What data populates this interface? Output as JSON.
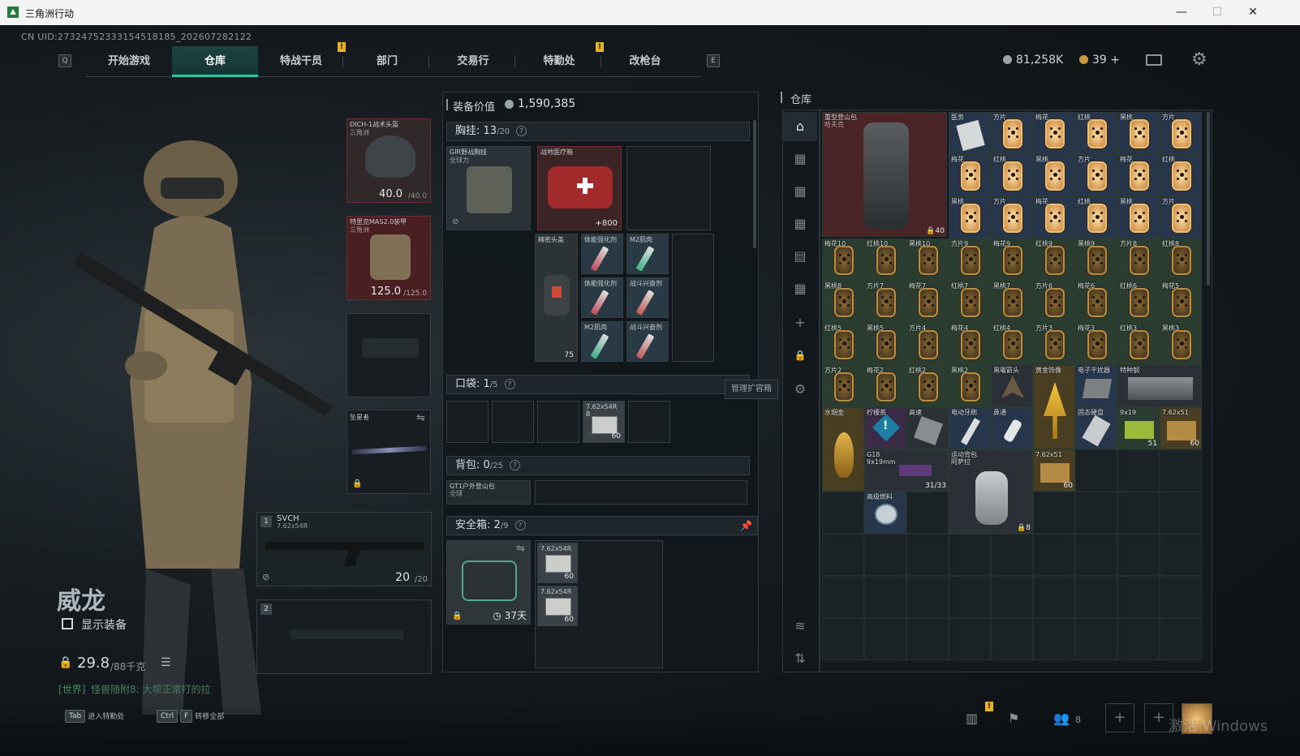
{
  "window": {
    "title": "三角洲行动",
    "minimize": "—",
    "maximize": "☐",
    "close": "✕"
  },
  "uid": "CN UID:2732475233315451818​5_202607282122",
  "nav": {
    "key_left": "Q",
    "key_right": "E",
    "tabs": [
      "开始游戏",
      "仓库",
      "特战干员",
      "部门",
      "交易行",
      "特勤处",
      "改枪台"
    ],
    "active_tab": "仓库",
    "notif_marker": "!"
  },
  "currency": {
    "silver": "81,258K",
    "gold": "39",
    "plus": "+"
  },
  "operator": {
    "name": "威龙",
    "show_gear_label": "显示装备",
    "weight_value": "29.8",
    "weight_max": "/88千克",
    "chat_channel": "[世界]",
    "chat_text": "怪兽随附8: 大坝正常打的拉"
  },
  "gear": {
    "helmet": {
      "name": "DICH-1战术头盔",
      "sub": "三角洲",
      "durability": "40.0",
      "max": "/40.0"
    },
    "armor": {
      "name": "特里克MAS2.0装甲",
      "sub": "三角洲",
      "durability": "125.0",
      "max": "/125.0"
    },
    "melee": {
      "name": "坠星者"
    },
    "primary": {
      "index": "1",
      "name": "SVCH",
      "caliber": "7.62x54R",
      "ammo": "20",
      "ammo_max": "/20"
    },
    "secondary": {
      "index": "2"
    }
  },
  "equipment": {
    "value_label": "装备价值",
    "value": "1,590,385",
    "chest": {
      "label": "胸挂:",
      "count": "13",
      "max": "/20"
    },
    "chest_rig": {
      "name": "GIR野战胸挂",
      "sub": "全球力"
    },
    "medkit": {
      "name": "战地医疗箱",
      "value": "800"
    },
    "headband": {
      "name": "精密头盖",
      "value": "75"
    },
    "consumables": [
      "体能强化剂",
      "M2肌肉",
      "体能强化剂",
      "战斗兴奋剂",
      "M2肌肉",
      "战斗兴奋剂"
    ],
    "pocket": {
      "label": "口袋:",
      "count": "1",
      "max": "/5",
      "item": "7.62x54R",
      "item_sub": "B",
      "item_count": "60"
    },
    "manage_label": "管理扩容箱",
    "backpack": {
      "label": "背包:",
      "count": "0",
      "max": "/25",
      "item": "GT1户外登山包",
      "item_sub": "全球"
    },
    "safe": {
      "label": "安全箱:",
      "count": "2",
      "max": "/9",
      "days": "37天",
      "ammo": [
        "7.62x54R",
        "7.62x54R"
      ],
      "ammo_count": [
        "60",
        "60"
      ]
    }
  },
  "warehouse": {
    "title": "仓库",
    "big_backpack": {
      "name": "重型登山包",
      "sub": "哈夫克",
      "count": "40"
    },
    "top_cells": [
      "医务",
      "方片",
      "梅花",
      "红桃",
      "黑桃",
      "方片",
      "梅花",
      "红桃",
      "黑桃",
      "方片",
      "梅花",
      "红桃",
      "黑桃",
      "方片",
      "梅花",
      "红桃",
      "黑桃",
      "方片"
    ],
    "grid_cells": [
      "梅花10",
      "红桃10",
      "黑桃10",
      "方片9",
      "梅花9",
      "红桃9",
      "黑桃9",
      "方片8",
      "红桃8",
      "黑桃8",
      "方片7",
      "梅花7",
      "红桃7",
      "黑桃7",
      "方片6",
      "梅花6",
      "红桃6",
      "梅花5",
      "红桃5",
      "黑桃5",
      "方片4",
      "梅花4",
      "红桃4",
      "方片3",
      "梅花3",
      "红桃3",
      "黑桃3",
      "方片2",
      "梅花2",
      "红桃2",
      "黑桃2"
    ],
    "misc": {
      "arrowhead": "黑曜箭头",
      "idol": "黄金饰像",
      "laptop": "电子干扰器",
      "plate": "特种钢",
      "hookah": "水烟壶",
      "alert": "柠檬茶",
      "chip": "高速",
      "toothbrush": "电动牙刷",
      "inhaler": "鼻通",
      "knife_case": "固态硬盘",
      "ammo919": "9x19",
      "ammo919_count": "51",
      "ammo762": "7.62x51",
      "ammo762_count": "60",
      "pistol": "G18",
      "pistol_cal": "9x19mm",
      "pistol_ammo": "31/33",
      "sport_bag": "运动背包",
      "sport_bag_sub": "阿萨拉",
      "sport_bag_count": "8",
      "ammo_box2": "7.62x51",
      "ammo_box2_count": "60",
      "canned": "高级燃料"
    }
  },
  "bottom": {
    "tab_key": "Tab",
    "tab_label": "进入特勤处",
    "ctrl_key": "Ctrl",
    "f_key": "F",
    "transfer_label": "转移全部",
    "friends_count": "8",
    "watermark": "激活 Windows"
  },
  "colors": {
    "accent": "#23c8a6",
    "notif": "#e5b22a",
    "slot_red": "#4a1f22"
  }
}
